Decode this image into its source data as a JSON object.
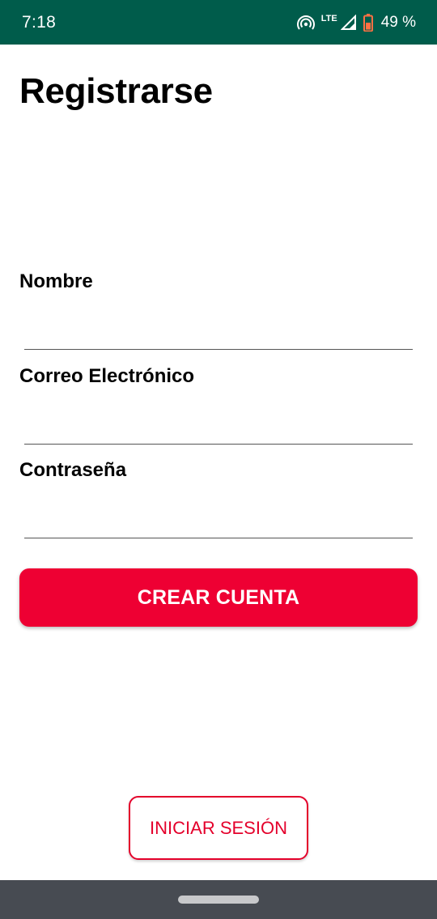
{
  "status_bar": {
    "time": "7:18",
    "network_label": "LTE",
    "battery_level": "49 %",
    "icons": [
      "hotspot-icon",
      "signal-icon",
      "battery-icon"
    ],
    "background_color": "#005c4b"
  },
  "page": {
    "title": "Registrarse"
  },
  "form": {
    "name_label": "Nombre",
    "name_value": "",
    "email_label": "Correo Electrónico",
    "email_value": "",
    "password_label": "Contraseña",
    "password_value": ""
  },
  "actions": {
    "create_account_label": "CREAR CUENTA",
    "login_label": "INICIAR SESIÓN"
  },
  "colors": {
    "accent": "#ee0033",
    "status_bar": "#005c4b",
    "nav_bar": "#474b52"
  }
}
